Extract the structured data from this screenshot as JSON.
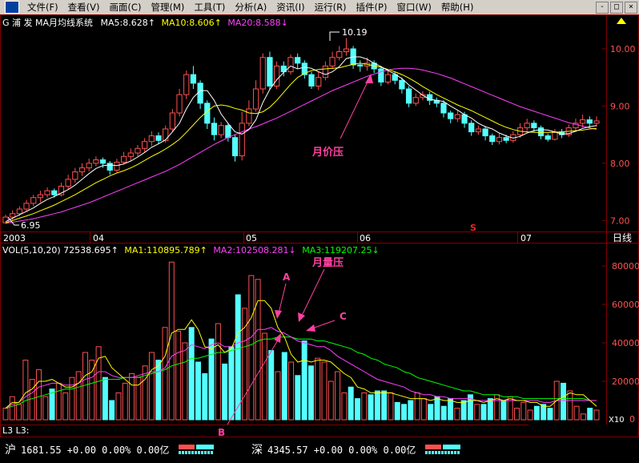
{
  "menubar": {
    "items": [
      "文件(F)",
      "查看(V)",
      "画面(C)",
      "管理(M)",
      "工具(T)",
      "分析(A)",
      "资讯(I)",
      "运行(R)",
      "插件(P)",
      "窗口(W)",
      "帮助(H)"
    ],
    "window_buttons": [
      "-",
      "□",
      "×"
    ]
  },
  "price_panel": {
    "indicator_label": "G 浦  发 MA月均线系统",
    "ma5_label": "MA5:8.628↑",
    "ma10_label": "MA10:8.606↑",
    "ma20_label": "MA20:8.588↓",
    "high_label": "10.19",
    "low_label": "6.95",
    "y_ticks": [
      "10.00",
      "9.00",
      "8.00",
      "7.00"
    ],
    "annotation": "月价压",
    "x_labels": [
      "2003",
      "04",
      "05",
      "06",
      "07"
    ],
    "period_label": "日线",
    "marker_s": "S"
  },
  "volume_panel": {
    "indicator_label": "VOL(5,10,20) 72538.695↑",
    "ma1_label": "MA1:110895.789↑",
    "ma2_label": "MA2:102508.281↓",
    "ma3_label": "MA3:119207.25↓",
    "y_ticks": [
      "80000",
      "60000",
      "40000",
      "20000",
      "0"
    ],
    "unit_label": "X10",
    "annotation": "月量压",
    "point_labels": [
      "A",
      "B",
      "C"
    ],
    "bottom_label": "L3 L3:"
  },
  "statusbar": {
    "sh_label": "沪",
    "sh_text": "1681.55 +0.00 0.00% 0.00亿",
    "sz_label": "深",
    "sz_text": "4345.57 +0.00 0.00% 0.00亿"
  },
  "colors": {
    "up": "#ff5050",
    "down": "#54ffff",
    "ma5": "#ffffff",
    "ma10": "#ffff00",
    "ma20": "#ff40ff",
    "vol_ma20": "#00ff00",
    "grid": "#800000",
    "annotation": "#ff40a0"
  },
  "chart_data": [
    {
      "type": "candlestick",
      "title": "G 浦  发 MA月均线系统",
      "x_labels": [
        "2003",
        "04",
        "05",
        "06",
        "07"
      ],
      "ylim": [
        6.85,
        10.35
      ],
      "y_ticks": [
        7.0,
        8.0,
        9.0,
        10.0
      ],
      "candles": [
        [
          6.96,
          7.06,
          6.95,
          7.1
        ],
        [
          7.06,
          7.12,
          7.0,
          7.18
        ],
        [
          7.12,
          7.2,
          7.08,
          7.25
        ],
        [
          7.2,
          7.3,
          7.15,
          7.36
        ],
        [
          7.3,
          7.4,
          7.25,
          7.45
        ],
        [
          7.4,
          7.45,
          7.32,
          7.52
        ],
        [
          7.45,
          7.52,
          7.4,
          7.58
        ],
        [
          7.52,
          7.45,
          7.4,
          7.56
        ],
        [
          7.45,
          7.6,
          7.42,
          7.66
        ],
        [
          7.6,
          7.72,
          7.55,
          7.8
        ],
        [
          7.72,
          7.85,
          7.66,
          7.92
        ],
        [
          7.85,
          7.92,
          7.78,
          8.0
        ],
        [
          7.92,
          8.0,
          7.86,
          8.08
        ],
        [
          8.0,
          8.06,
          7.95,
          8.12
        ],
        [
          8.06,
          8.0,
          7.92,
          8.1
        ],
        [
          8.0,
          7.88,
          7.8,
          8.04
        ],
        [
          7.88,
          8.02,
          7.84,
          8.08
        ],
        [
          8.02,
          8.12,
          7.98,
          8.2
        ],
        [
          8.12,
          8.18,
          8.05,
          8.26
        ],
        [
          8.18,
          8.26,
          8.12,
          8.32
        ],
        [
          8.26,
          8.38,
          8.2,
          8.44
        ],
        [
          8.38,
          8.48,
          8.3,
          8.56
        ],
        [
          8.48,
          8.4,
          8.34,
          8.54
        ],
        [
          8.4,
          8.6,
          8.36,
          8.66
        ],
        [
          8.6,
          8.88,
          8.55,
          8.95
        ],
        [
          8.88,
          9.2,
          8.82,
          9.3
        ],
        [
          9.2,
          9.55,
          9.12,
          9.62
        ],
        [
          9.55,
          9.4,
          9.3,
          9.7
        ],
        [
          9.4,
          9.05,
          8.95,
          9.45
        ],
        [
          9.05,
          8.7,
          8.6,
          9.1
        ],
        [
          8.7,
          8.5,
          8.4,
          8.8
        ],
        [
          8.5,
          8.66,
          8.44,
          8.72
        ],
        [
          8.66,
          8.45,
          8.38,
          8.7
        ],
        [
          8.45,
          8.13,
          8.03,
          8.5
        ],
        [
          8.13,
          8.7,
          8.05,
          8.9
        ],
        [
          8.7,
          8.95,
          8.65,
          9.1
        ],
        [
          8.95,
          9.3,
          8.9,
          9.45
        ],
        [
          9.3,
          9.85,
          9.22,
          9.92
        ],
        [
          9.85,
          9.35,
          9.28,
          9.95
        ],
        [
          9.35,
          9.7,
          9.3,
          9.78
        ],
        [
          9.7,
          9.6,
          9.52,
          9.78
        ],
        [
          9.6,
          9.85,
          9.55,
          9.9
        ],
        [
          9.85,
          9.75,
          9.65,
          9.92
        ],
        [
          9.75,
          9.55,
          9.48,
          9.8
        ],
        [
          9.55,
          9.35,
          9.3,
          9.6
        ],
        [
          9.35,
          9.5,
          9.28,
          9.6
        ],
        [
          9.5,
          9.7,
          9.45,
          9.78
        ],
        [
          9.7,
          9.85,
          9.65,
          9.95
        ],
        [
          9.85,
          9.95,
          9.8,
          10.05
        ],
        [
          9.95,
          10.0,
          9.88,
          10.19
        ],
        [
          10.0,
          9.72,
          9.65,
          10.05
        ],
        [
          9.72,
          9.7,
          9.6,
          9.8
        ],
        [
          9.7,
          9.75,
          9.62,
          9.85
        ],
        [
          9.75,
          9.65,
          9.58,
          9.8
        ],
        [
          9.65,
          9.42,
          9.35,
          9.7
        ],
        [
          9.42,
          9.55,
          9.38,
          9.62
        ],
        [
          9.55,
          9.45,
          9.38,
          9.6
        ],
        [
          9.45,
          9.3,
          9.22,
          9.5
        ],
        [
          9.3,
          9.05,
          8.98,
          9.35
        ],
        [
          9.05,
          9.15,
          9.0,
          9.22
        ],
        [
          9.15,
          9.2,
          9.1,
          9.26
        ],
        [
          9.2,
          9.1,
          9.02,
          9.25
        ],
        [
          9.1,
          9.05,
          8.98,
          9.15
        ],
        [
          9.05,
          8.88,
          8.8,
          9.1
        ],
        [
          8.88,
          8.78,
          8.7,
          8.92
        ],
        [
          8.78,
          8.85,
          8.72,
          8.92
        ],
        [
          8.85,
          8.7,
          8.62,
          8.9
        ],
        [
          8.7,
          8.55,
          8.48,
          8.75
        ],
        [
          8.55,
          8.6,
          8.5,
          8.66
        ],
        [
          8.6,
          8.48,
          8.4,
          8.65
        ],
        [
          8.48,
          8.38,
          8.32,
          8.52
        ],
        [
          8.38,
          8.45,
          8.33,
          8.52
        ],
        [
          8.45,
          8.4,
          8.35,
          8.5
        ],
        [
          8.4,
          8.5,
          8.36,
          8.56
        ],
        [
          8.5,
          8.62,
          8.45,
          8.7
        ],
        [
          8.62,
          8.7,
          8.56,
          8.78
        ],
        [
          8.7,
          8.62,
          8.55,
          8.75
        ],
        [
          8.62,
          8.48,
          8.42,
          8.66
        ],
        [
          8.48,
          8.42,
          8.38,
          8.52
        ],
        [
          8.42,
          8.55,
          8.4,
          8.6
        ],
        [
          8.55,
          8.5,
          8.44,
          8.6
        ],
        [
          8.5,
          8.62,
          8.46,
          8.68
        ],
        [
          8.62,
          8.7,
          8.56,
          8.78
        ],
        [
          8.7,
          8.76,
          8.62,
          8.85
        ],
        [
          8.76,
          8.7,
          8.62,
          8.82
        ],
        [
          8.7,
          8.74,
          8.64,
          8.82
        ]
      ],
      "ma5": [
        6.98,
        7.04,
        7.1,
        7.16,
        7.22,
        7.3,
        7.37,
        7.42,
        7.48,
        7.54,
        7.62,
        7.72,
        7.82,
        7.91,
        7.96,
        7.97,
        7.96,
        7.99,
        8.04,
        8.11,
        8.19,
        8.28,
        8.34,
        8.41,
        8.55,
        8.7,
        8.95,
        9.15,
        9.27,
        9.27,
        9.1,
        8.86,
        8.7,
        8.55,
        8.51,
        8.59,
        8.76,
        9.06,
        9.29,
        9.46,
        9.59,
        9.7,
        9.65,
        9.68,
        9.66,
        9.6,
        9.55,
        9.6,
        9.69,
        9.83,
        9.86,
        9.86,
        9.82,
        9.75,
        9.69,
        9.62,
        9.56,
        9.48,
        9.37,
        9.28,
        9.19,
        9.12,
        9.1,
        9.08,
        9.0,
        8.93,
        8.85,
        8.79,
        8.7,
        8.64,
        8.6,
        8.53,
        8.48,
        8.44,
        8.47,
        8.53,
        8.57,
        8.59,
        8.58,
        8.55,
        8.51,
        8.52,
        8.56,
        8.61,
        8.64,
        8.66
      ],
      "ma10": [
        6.96,
        7.0,
        7.04,
        7.08,
        7.12,
        7.17,
        7.22,
        7.27,
        7.33,
        7.39,
        7.45,
        7.52,
        7.59,
        7.66,
        7.72,
        7.78,
        7.83,
        7.87,
        7.92,
        7.98,
        8.05,
        8.12,
        8.18,
        8.25,
        8.33,
        8.42,
        8.54,
        8.67,
        8.8,
        8.91,
        9.0,
        9.02,
        9.0,
        8.96,
        8.93,
        8.88,
        8.87,
        8.9,
        8.98,
        9.1,
        9.24,
        9.38,
        9.5,
        9.57,
        9.62,
        9.64,
        9.65,
        9.66,
        9.67,
        9.7,
        9.73,
        9.75,
        9.73,
        9.7,
        9.68,
        9.64,
        9.6,
        9.55,
        9.49,
        9.42,
        9.34,
        9.27,
        9.2,
        9.14,
        9.08,
        9.02,
        8.97,
        8.92,
        8.86,
        8.8,
        8.74,
        8.68,
        8.63,
        8.59,
        8.56,
        8.55,
        8.54,
        8.54,
        8.54,
        8.54,
        8.55,
        8.56,
        8.57,
        8.58,
        8.6,
        8.61
      ],
      "ma20": [
        6.95,
        6.97,
        6.99,
        7.01,
        7.03,
        7.06,
        7.09,
        7.12,
        7.15,
        7.19,
        7.23,
        7.27,
        7.31,
        7.36,
        7.41,
        7.46,
        7.51,
        7.56,
        7.61,
        7.66,
        7.71,
        7.76,
        7.81,
        7.86,
        7.92,
        7.98,
        8.05,
        8.12,
        8.19,
        8.26,
        8.33,
        8.39,
        8.45,
        8.5,
        8.55,
        8.6,
        8.64,
        8.69,
        8.74,
        8.79,
        8.85,
        8.91,
        8.97,
        9.03,
        9.09,
        9.15,
        9.21,
        9.27,
        9.32,
        9.37,
        9.42,
        9.47,
        9.52,
        9.56,
        9.6,
        9.63,
        9.65,
        9.66,
        9.66,
        9.65,
        9.63,
        9.6,
        9.57,
        9.53,
        9.49,
        9.44,
        9.39,
        9.34,
        9.29,
        9.24,
        9.19,
        9.14,
        9.09,
        9.04,
        8.99,
        8.95,
        8.91,
        8.87,
        8.83,
        8.79,
        8.75,
        8.71,
        8.68,
        8.65,
        8.62,
        8.59
      ]
    },
    {
      "type": "bar",
      "title": "VOL(5,10,20)",
      "ylim": [
        0,
        85000
      ],
      "y_ticks": [
        0,
        20000,
        40000,
        60000,
        80000
      ],
      "values": [
        6000,
        12000,
        8000,
        31000,
        21000,
        26000,
        12000,
        16000,
        19000,
        14000,
        22000,
        25000,
        35000,
        31000,
        38000,
        22000,
        10000,
        14000,
        19000,
        24000,
        22000,
        28000,
        35000,
        31000,
        48000,
        82000,
        46000,
        40000,
        48000,
        30000,
        24000,
        42000,
        50000,
        29000,
        38000,
        65000,
        58000,
        75000,
        73000,
        45000,
        36000,
        25000,
        35000,
        30000,
        23000,
        41000,
        28000,
        32000,
        30000,
        20000,
        25000,
        14000,
        17000,
        11000,
        14000,
        13000,
        15000,
        15000,
        14000,
        9000,
        8000,
        10000,
        14000,
        11000,
        8000,
        12000,
        7000,
        11000,
        6000,
        10000,
        13000,
        8000,
        8000,
        11000,
        13000,
        10000,
        12000,
        6000,
        9000,
        5000,
        7000,
        8000,
        6000,
        20000,
        19000,
        15000,
        7000,
        3000,
        6000,
        5000
      ],
      "ma5": [
        6000,
        9000,
        9000,
        14000,
        16000,
        20000,
        20000,
        21000,
        19000,
        17000,
        17000,
        19000,
        23000,
        25000,
        32000,
        33000,
        27000,
        24000,
        21000,
        18000,
        18000,
        21000,
        26000,
        28000,
        33000,
        45000,
        47000,
        47000,
        52000,
        47000,
        38000,
        37000,
        39000,
        35000,
        37000,
        45000,
        48000,
        53000,
        62000,
        62000,
        58000,
        48000,
        43000,
        34000,
        30000,
        31000,
        30000,
        31000,
        31000,
        30000,
        27000,
        24000,
        22000,
        17000,
        16000,
        14000,
        14000,
        14000,
        14000,
        13000,
        12000,
        11000,
        11000,
        11000,
        10000,
        11000,
        10000,
        10000,
        9000,
        9000,
        10000,
        10000,
        9000,
        10000,
        11000,
        10000,
        11000,
        10000,
        10000,
        9000,
        9000,
        7000,
        7000,
        10000,
        12000,
        14000,
        13000,
        13000,
        10000,
        7000
      ],
      "ma10": [
        6000,
        8000,
        9000,
        12000,
        14000,
        17000,
        18000,
        19000,
        19000,
        18000,
        18000,
        19000,
        21000,
        22000,
        25000,
        25000,
        23000,
        22000,
        22000,
        22000,
        23000,
        24000,
        25000,
        25000,
        27000,
        33000,
        35000,
        36000,
        39000,
        38000,
        37000,
        39000,
        40000,
        38000,
        38000,
        40000,
        41000,
        43000,
        47000,
        47000,
        48000,
        46000,
        45000,
        43000,
        41000,
        40000,
        39000,
        38000,
        38000,
        36000,
        33000,
        31000,
        29000,
        27000,
        25000,
        23000,
        21000,
        20000,
        19000,
        18000,
        17000,
        15000,
        14000,
        13000,
        13000,
        12000,
        12000,
        11000,
        11000,
        11000,
        11000,
        10000,
        10000,
        10000,
        10000,
        10000,
        10000,
        10000,
        10000,
        10000,
        10000,
        9000,
        9000,
        10000,
        10000,
        10000,
        10000,
        10000,
        10000,
        10000
      ],
      "ma20": [
        6000,
        7000,
        8000,
        10000,
        11000,
        12000,
        13000,
        14000,
        15000,
        16000,
        16000,
        17000,
        18000,
        19000,
        20000,
        21000,
        21000,
        21000,
        22000,
        22000,
        22000,
        23000,
        24000,
        25000,
        26000,
        28000,
        29000,
        30000,
        32000,
        32000,
        33000,
        34000,
        35000,
        35000,
        36000,
        37000,
        38000,
        39000,
        41000,
        42000,
        42000,
        43000,
        43000,
        43000,
        42000,
        42000,
        42000,
        41000,
        41000,
        40000,
        39000,
        38000,
        37000,
        35000,
        34000,
        32000,
        31000,
        29000,
        28000,
        27000,
        25000,
        24000,
        22000,
        21000,
        20000,
        19000,
        18000,
        17000,
        16000,
        15000,
        15000,
        14000,
        13000,
        13000,
        13000,
        12000,
        12000,
        12000,
        11000,
        11000,
        11000,
        11000,
        11000,
        11000,
        11000,
        11000,
        11000,
        11000,
        10000,
        10000
      ]
    }
  ]
}
